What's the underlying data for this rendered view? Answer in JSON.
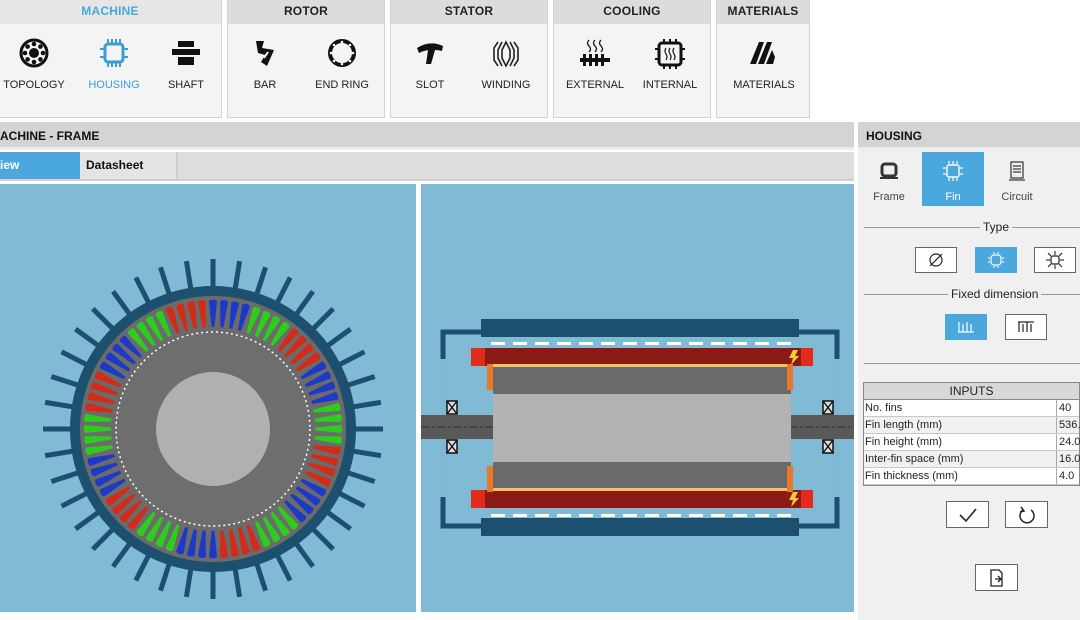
{
  "ribbon": {
    "groups": [
      {
        "title": "MACHINE",
        "active": true,
        "items": [
          {
            "label": "TOPOLOGY",
            "icon": "topology-icon"
          },
          {
            "label": "HOUSING",
            "icon": "housing-icon",
            "selected": true
          },
          {
            "label": "SHAFT",
            "icon": "shaft-icon"
          }
        ]
      },
      {
        "title": "ROTOR",
        "items": [
          {
            "label": "BAR",
            "icon": "bar-icon"
          },
          {
            "label": "END RING",
            "icon": "end-ring-icon"
          }
        ]
      },
      {
        "title": "STATOR",
        "items": [
          {
            "label": "SLOT",
            "icon": "slot-icon"
          },
          {
            "label": "WINDING",
            "icon": "winding-icon"
          }
        ]
      },
      {
        "title": "COOLING",
        "items": [
          {
            "label": "EXTERNAL",
            "icon": "external-cooling-icon"
          },
          {
            "label": "INTERNAL",
            "icon": "internal-cooling-icon"
          }
        ]
      },
      {
        "title": "MATERIALS",
        "items": [
          {
            "label": "MATERIALS",
            "icon": "materials-icon"
          }
        ]
      }
    ]
  },
  "main": {
    "section_title": "ACHINE - FRAME",
    "tabs": [
      {
        "label": "iew",
        "active": true
      },
      {
        "label": "Datasheet",
        "active": false
      }
    ]
  },
  "panel": {
    "title": "HOUSING",
    "tabs": [
      {
        "label": "Frame",
        "icon": "frame-icon"
      },
      {
        "label": "Fin",
        "icon": "fin-icon",
        "selected": true
      },
      {
        "label": "Circuit",
        "icon": "circuit-icon"
      }
    ],
    "type_label": "Type",
    "type_options": [
      {
        "icon": "no-fins-icon"
      },
      {
        "icon": "radial-fins-icon",
        "selected": true
      },
      {
        "icon": "sun-fins-icon"
      }
    ],
    "fixed_label": "Fixed dimension",
    "fixed_options": [
      {
        "icon": "fin-spacing-icon",
        "selected": true
      },
      {
        "icon": "fin-count-icon"
      }
    ],
    "inputs_title": "INPUTS",
    "inputs": [
      {
        "label": "No. fins",
        "value": "40"
      },
      {
        "label": "Fin length (mm)",
        "value": "536."
      },
      {
        "label": "Fin height (mm)",
        "value": "24.0"
      },
      {
        "label": "Inter-fin space (mm)",
        "value": "16.0"
      },
      {
        "label": "Fin thickness (mm)",
        "value": "4.0"
      }
    ]
  },
  "colors": {
    "accent": "#4aa8dc",
    "viewport": "#80bad5",
    "frame": "#1d4f6e",
    "stator": "#6b6b6b",
    "rotor": "#aaaaaa"
  }
}
